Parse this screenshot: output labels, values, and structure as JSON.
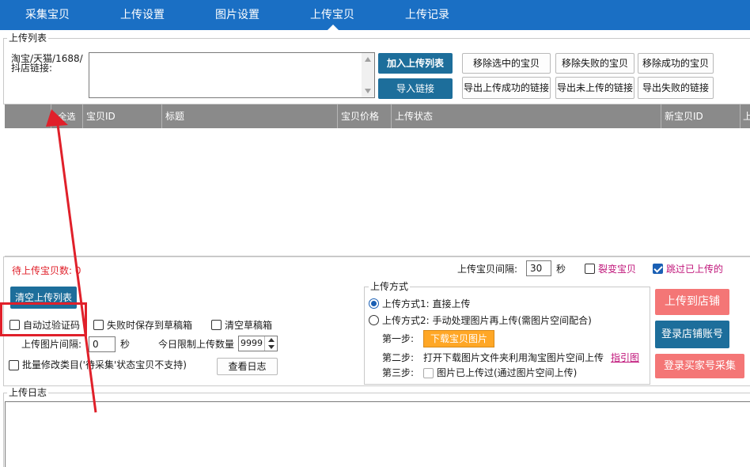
{
  "nav": {
    "tabs": [
      "采集宝贝",
      "上传设置",
      "图片设置",
      "上传宝贝",
      "上传记录"
    ],
    "active": "上传宝贝"
  },
  "upload_list": {
    "group_title": "上传列表",
    "link_label_1": "淘宝/天猫/1688/",
    "link_label_2": "抖店链接:",
    "add_button": "加入上传列表",
    "import_button": "导入链接",
    "remove_selected": "移除选中的宝贝",
    "remove_failed": "移除失败的宝贝",
    "remove_success": "移除成功的宝贝",
    "export_success": "导出上传成功的链接",
    "export_not_uploaded": "导出未上传的链接",
    "export_failed": "导出失败的链接"
  },
  "table": {
    "columns": [
      "全选",
      "宝贝ID",
      "标题",
      "宝贝价格",
      "上传状态",
      "新宝贝ID",
      "上传时间"
    ]
  },
  "controls": {
    "pending_count_label": "待上传宝贝数:",
    "pending_count": "0",
    "interval_label": "上传宝贝间隔:",
    "interval_value": "30",
    "interval_unit": "秒",
    "variant_label": "裂变宝贝",
    "skip_uploaded_label": "跳过已上传的",
    "clear_list_button": "清空上传列表",
    "auto_captcha_label": "自动过验证码",
    "save_draft_label": "失败时保存到草稿箱",
    "clear_draft_label": "清空草稿箱",
    "image_interval_label": "上传图片间隔:",
    "image_interval_value": "0",
    "image_interval_unit": "秒",
    "daily_limit_label": "今日限制上传数量",
    "daily_limit_value": "9999",
    "batch_modify_label": "批量修改类目('待采集'状态宝贝不支持)",
    "view_log_button": "查看日志"
  },
  "upload_method": {
    "group_title": "上传方式",
    "option1": "上传方式1: 直接上传",
    "option2": "上传方式2: 手动处理图片再上传(需图片空间配合)",
    "step1_label": "第一步:",
    "step1_button": "下载宝贝图片",
    "step2_label": "第二步:",
    "step2_text": "打开下载图片文件夹利用淘宝图片空间上传",
    "guide_link": "指引图",
    "step3_label": "第三步:",
    "step3_text": "图片已上传过(通过图片空间上传)"
  },
  "actions": {
    "upload_store": "上传到店铺",
    "login_store": "登录店铺账号",
    "login_buyer": "登录买家号采集"
  },
  "log": {
    "group_title": "上传日志"
  },
  "colors": {
    "nav_bg": "#1a6fc4",
    "primary_btn": "#1d6e9b",
    "danger_btn": "#f47676",
    "orange_btn": "#ffa726",
    "highlight": "#e0202a",
    "pending_text": "#e0202a",
    "link_text": "#c0157a"
  }
}
